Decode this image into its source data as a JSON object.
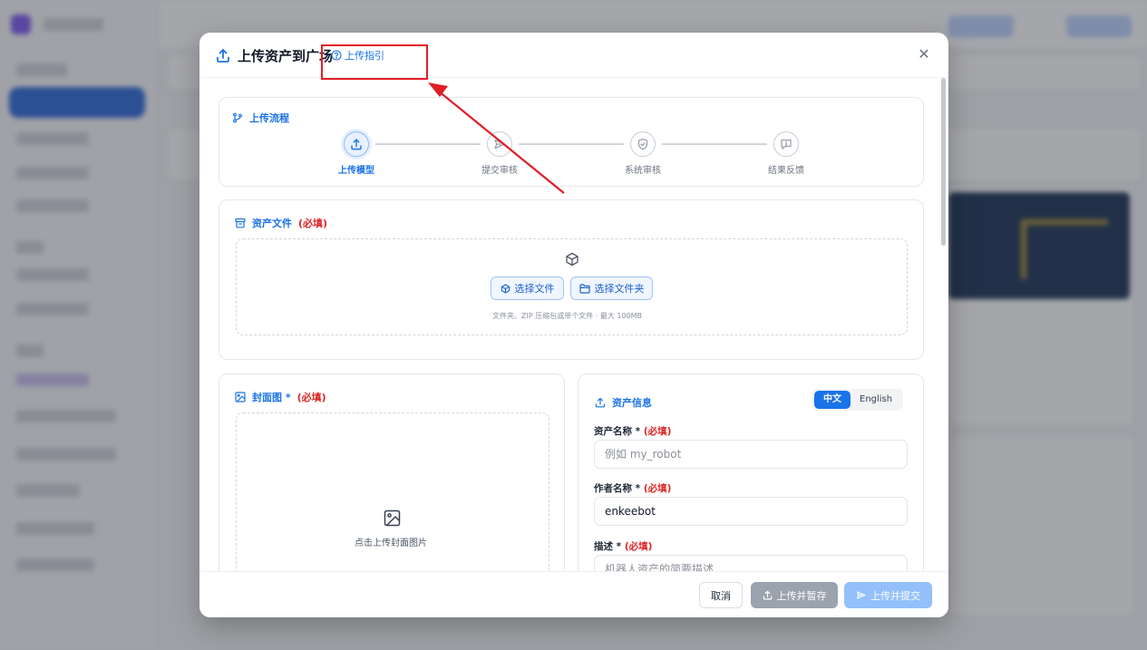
{
  "modal": {
    "title": "上传资产到广场",
    "guide_link": "上传指引",
    "close_icon": "close-icon"
  },
  "process": {
    "title": "上传流程",
    "steps": [
      {
        "label": "上传模型",
        "icon": "upload-icon",
        "active": true
      },
      {
        "label": "提交审核",
        "icon": "send-icon",
        "active": false
      },
      {
        "label": "系统审核",
        "icon": "shield-check-icon",
        "active": false
      },
      {
        "label": "结果反馈",
        "icon": "message-icon",
        "active": false
      }
    ]
  },
  "asset_file": {
    "title": "资产文件",
    "required": "(必填)",
    "select_file": "选择文件",
    "select_folder": "选择文件夹",
    "hint": "文件夹、ZIP 压缩包或单个文件 · 最大 100MB"
  },
  "cover": {
    "title": "封面图 *",
    "required": "(必填)",
    "upload_text": "点击上传封面图片"
  },
  "asset_info": {
    "title": "资产信息",
    "lang_options": [
      "中文",
      "English"
    ],
    "lang_selected": "中文",
    "name_label": "资产名称 *",
    "name_required": "(必填)",
    "name_placeholder": "例如 my_robot",
    "author_label": "作者名称 *",
    "author_required": "(必填)",
    "author_value": "enkeebot",
    "desc_label": "描述 *",
    "desc_required": "(必填)",
    "desc_placeholder": "机器人资产的简要描述"
  },
  "footer": {
    "cancel": "取消",
    "upload_draft": "上传并暂存",
    "upload_submit": "上传并提交"
  },
  "colors": {
    "accent": "#1a73e8",
    "required": "#dc2626",
    "annotation": "#e11d24"
  }
}
